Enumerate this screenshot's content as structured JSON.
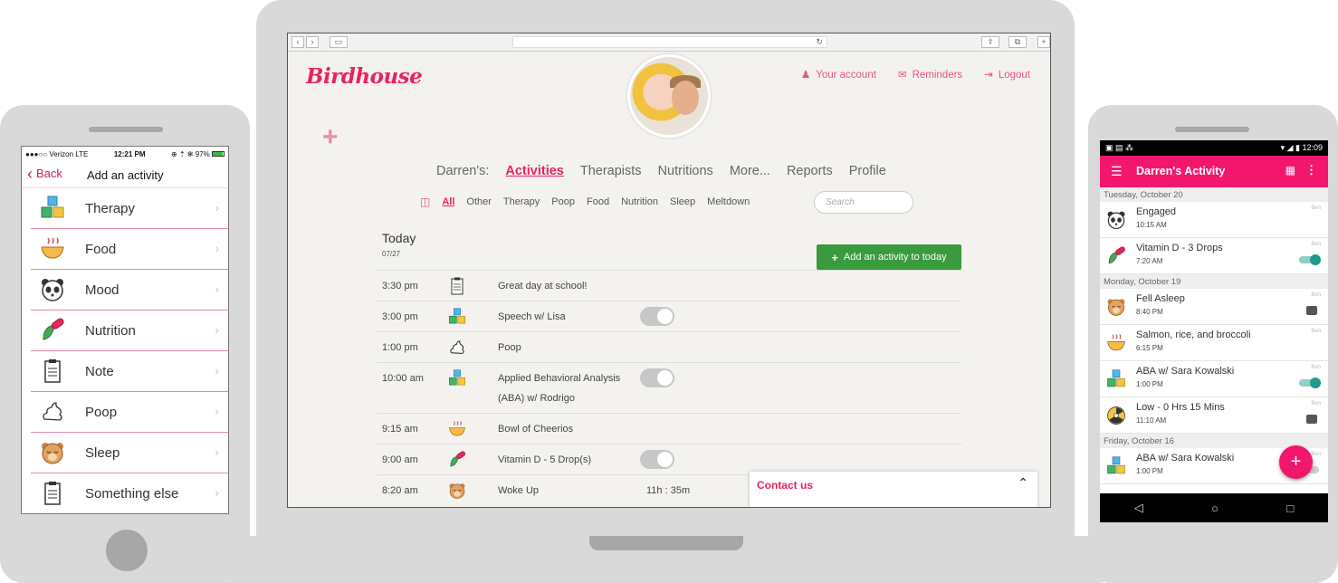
{
  "iphone": {
    "status": {
      "carrier": "●●●○○ Verizon  LTE",
      "time": "12:21 PM",
      "battery": "97%",
      "status_icons": "⊕ ⇡ ✻"
    },
    "nav": {
      "back_label": "Back",
      "title": "Add an activity"
    },
    "items": [
      {
        "label": "Therapy",
        "icon": "blocks-icon"
      },
      {
        "label": "Food",
        "icon": "bowl-icon"
      },
      {
        "label": "Mood",
        "icon": "panda-icon"
      },
      {
        "label": "Nutrition",
        "icon": "pill-leaf-icon"
      },
      {
        "label": "Note",
        "icon": "clipboard-icon"
      },
      {
        "label": "Poop",
        "icon": "poop-icon"
      },
      {
        "label": "Sleep",
        "icon": "bear-icon"
      },
      {
        "label": "Something else",
        "icon": "clipboard-icon"
      }
    ]
  },
  "laptop": {
    "logo": "Birdhouse",
    "top_links": {
      "account": "Your account",
      "reminders": "Reminders",
      "logout": "Logout"
    },
    "main_nav": {
      "prefix": "Darren's:",
      "activities": "Activities",
      "therapists": "Therapists",
      "nutritions": "Nutritions",
      "more": "More...",
      "reports": "Reports",
      "profile": "Profile"
    },
    "filters": {
      "all": "All",
      "other": "Other",
      "therapy": "Therapy",
      "poop": "Poop",
      "food": "Food",
      "nutrition": "Nutrition",
      "sleep": "Sleep",
      "meltdown": "Meltdown"
    },
    "search_placeholder": "Search",
    "today_label": "Today",
    "today_date": "07/27",
    "add_button": "Add an activity to today",
    "activities": [
      {
        "time": "3:30 pm",
        "desc": "Great day at school!"
      },
      {
        "time": "3:00 pm",
        "desc": "Speech w/ Lisa"
      },
      {
        "time": "1:00 pm",
        "desc": "Poop"
      },
      {
        "time": "10:00 am",
        "desc": "Applied Behavioral Analysis (ABA) w/ Rodrigo"
      },
      {
        "time": "9:15 am",
        "desc": "Bowl of Cheerios"
      },
      {
        "time": "9:00 am",
        "desc": "Vitamin D - 5 Drop(s)"
      },
      {
        "time": "8:20 am",
        "desc": "Woke Up",
        "duration": "11h : 35m"
      }
    ],
    "contact_label": "Contact us"
  },
  "android": {
    "status_time": "12:09",
    "title": "Darren's Activity",
    "sections": {
      "s1": "Tuesday, October 20",
      "s2": "Monday, October 19",
      "s3": "Friday, October 16"
    },
    "rows": [
      {
        "name": "Engaged",
        "time": "10:15 AM",
        "who": "Ben"
      },
      {
        "name": "Vitamin D - 3 Drops",
        "time": "7:20 AM",
        "who": "Ben"
      },
      {
        "name": "Fell Asleep",
        "time": "8:40 PM",
        "who": "Ben"
      },
      {
        "name": "Salmon, rice, and broccoli",
        "time": "6:15 PM",
        "who": "Ben"
      },
      {
        "name": "ABA w/ Sara Kowalski",
        "time": "1:00 PM",
        "who": "Ben"
      },
      {
        "name": "Low - 0 Hrs 15 Mins",
        "time": "11:10 AM",
        "who": "Ben"
      },
      {
        "name": "ABA w/ Sara Kowalski",
        "time": "1:00 PM",
        "who": "Ben"
      }
    ],
    "fab": "+"
  },
  "colors": {
    "brand_pink": "#e8245c",
    "android_pink": "#f2176d",
    "add_green": "#3a9a3e",
    "toggle_teal": "#1d9a8a"
  }
}
